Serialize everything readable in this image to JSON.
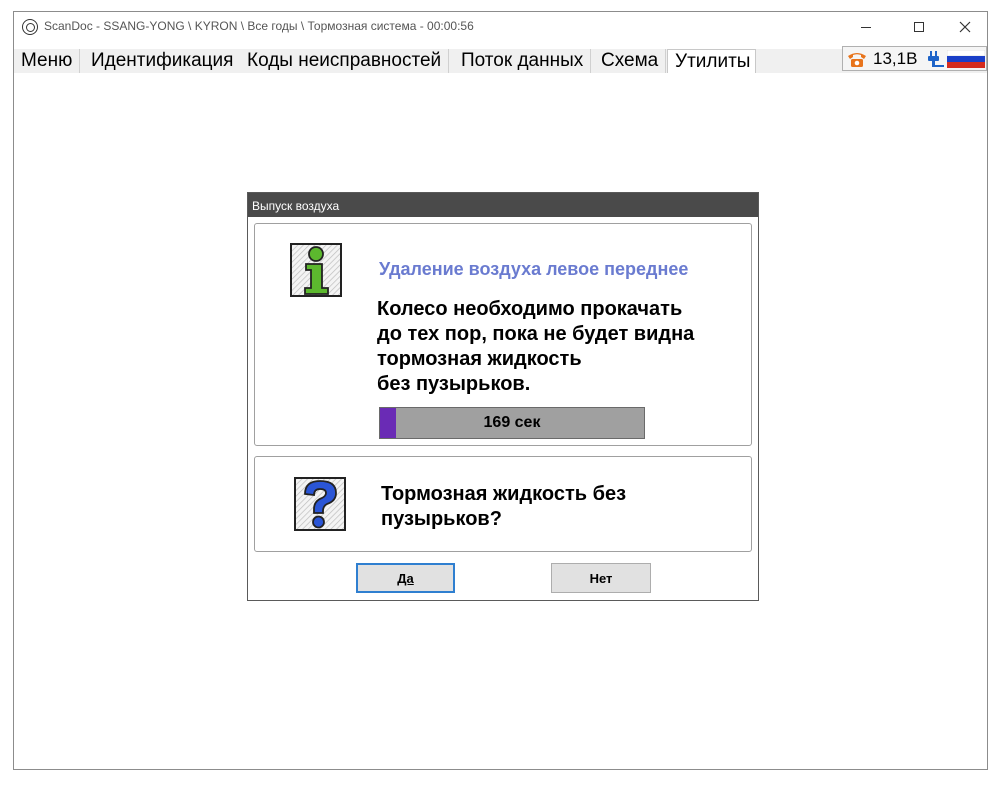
{
  "window": {
    "title": "ScanDoc - SSANG-YONG \\ KYRON \\ Все годы \\ Тормозная система - 00:00:56"
  },
  "menu": {
    "tabs": [
      {
        "label": "Меню"
      },
      {
        "label": "Идентификация"
      },
      {
        "label": "Коды неисправностей"
      },
      {
        "label": "Поток данных"
      },
      {
        "label": "Схема"
      },
      {
        "label": "Утилиты"
      }
    ],
    "active_tab": "Утилиты"
  },
  "status": {
    "voltage": "13,1В",
    "icons": [
      "phone-icon",
      "plug-icon",
      "russia-flag-icon"
    ]
  },
  "dialog": {
    "title": "Выпуск воздуха",
    "info": {
      "heading": "Удаление воздуха левое переднее",
      "message_lines": [
        "Колесо необходимо прокачать",
        "до тех пор, пока не будет видна",
        "тормозная жидкость",
        "без пузырьков."
      ],
      "progress_fraction": 0.06,
      "progress_label": "169 сек"
    },
    "question": {
      "text_lines": [
        "Тормозная жидкость без",
        "пузырьков?"
      ]
    },
    "buttons": {
      "yes": "Да",
      "no": "Нет"
    }
  },
  "colors": {
    "heading": "#6a7bd0",
    "progress_fill": "#6a2bb5",
    "progress_track": "#a0a0a0",
    "dialog_header": "#4a4a4a",
    "icon_green": "#5cb82e",
    "icon_blue": "#2a55d6"
  }
}
